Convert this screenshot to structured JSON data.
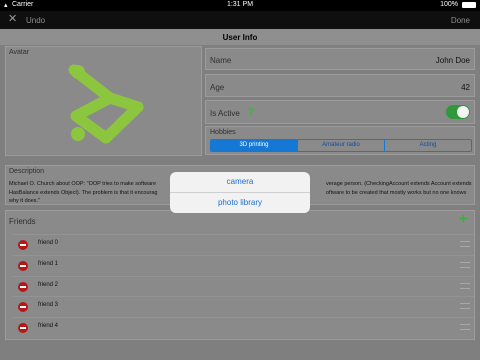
{
  "status_bar": {
    "carrier": "Carrier",
    "time": "1:31 PM",
    "battery": "100%"
  },
  "nav": {
    "undo_label": "Undo",
    "done_label": "Done"
  },
  "title": "User Info",
  "avatar_label": "Avatar",
  "name": {
    "label": "Name",
    "value": "John Doe"
  },
  "age": {
    "label": "Age",
    "value": "42"
  },
  "active": {
    "label": "Is Active",
    "help": "?"
  },
  "hobbies": {
    "label": "Hobbies",
    "options": [
      "3D printing",
      "Amateur radio",
      "Acting"
    ],
    "selected": 0
  },
  "description": {
    "label": "Description",
    "line1a": "Michael O. Church about OOP: \"OOP tries to make software",
    "line1b": "verage person. (CheckingAccount extends Account extends",
    "line2a": "HasBalance extends Object). The problem is that it encourag",
    "line2b": "oftware to be created that mostly works but no one knows",
    "line3": "why it does.\""
  },
  "friends": {
    "label": "Friends",
    "add": "+",
    "items": [
      "friend 0",
      "friend 1",
      "friend 2",
      "friend 3",
      "friend 4"
    ]
  },
  "popover": {
    "items": [
      "camera",
      "photo library"
    ]
  },
  "colors": {
    "accent": "#1478d4",
    "toggle": "#2e9a3c",
    "brand": "#8cc63f",
    "delete": "#b51818"
  }
}
